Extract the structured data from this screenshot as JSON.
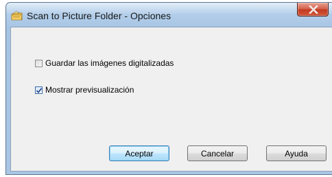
{
  "window": {
    "title": "Scan to Picture Folder - Opciones",
    "icon": "folder-scan-icon",
    "close_icon": "close-x-icon"
  },
  "options": [
    {
      "label": "Guardar las imágenes digitalizadas",
      "checked": false
    },
    {
      "label": "Mostrar previsualización",
      "checked": true
    }
  ],
  "buttons": {
    "ok_label": "Aceptar",
    "cancel_label": "Cancelar",
    "help_label": "Ayuda"
  },
  "colors": {
    "title_bar": "#b2cde9",
    "close_button": "#c23a22",
    "dialog_bg": "#f0f0f0",
    "default_button": "#a7d9f5"
  }
}
